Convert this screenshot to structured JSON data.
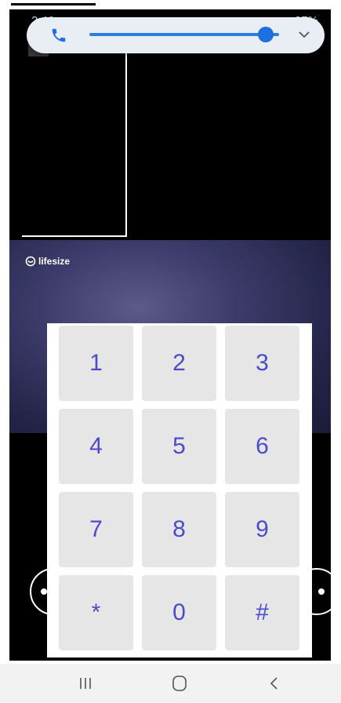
{
  "status_bar": {
    "time": "2:46",
    "battery": "27%"
  },
  "volume_panel": {
    "level_fraction": 0.93,
    "stream_icon": "phone-icon",
    "expand_icon": "chevron-down-icon"
  },
  "brand": {
    "name": "lifesize"
  },
  "keypad": {
    "keys": [
      "1",
      "2",
      "3",
      "4",
      "5",
      "6",
      "7",
      "8",
      "9",
      "*",
      "0",
      "#"
    ]
  },
  "nav_bar": {
    "recent_icon": "recent-apps-icon",
    "home_icon": "home-icon",
    "back_icon": "back-icon"
  },
  "colors": {
    "key_text": "#4c4bc9",
    "key_background": "#e6e6e6",
    "volume_accent": "#1e6fe0"
  }
}
